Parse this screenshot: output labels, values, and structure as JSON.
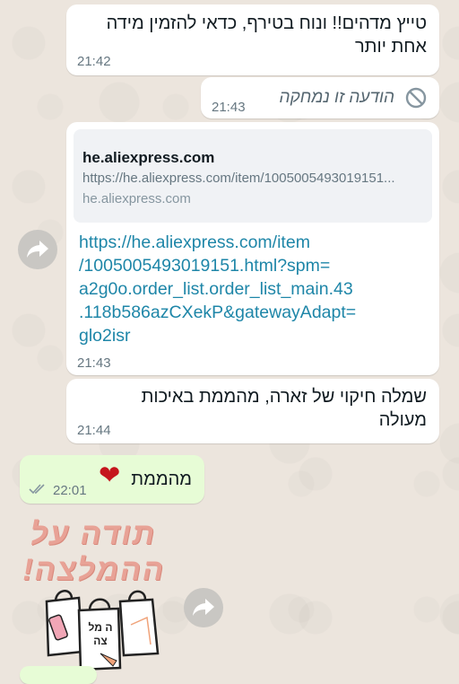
{
  "messages": [
    {
      "text_line1": "טייץ מדהים!! ונוח בטירף, כדאי להזמין מידה",
      "text_line2": "אחת יותר",
      "time": "21:42"
    },
    {
      "text": "הודעה זו נמחקה",
      "time": "21:43"
    },
    {
      "preview_title": "he.aliexpress.com",
      "preview_url": "https://he.aliexpress.com/item/1005005493019151...",
      "preview_domain": "he.aliexpress.com",
      "link_lines": [
        "https://he.aliexpress.com/item",
        "/1005005493019151.html?spm=",
        "a2g0o.order_list.order_list_main.43",
        ".118b586azCXekP&gatewayAdapt=",
        "glo2isr"
      ],
      "time": "21:43"
    },
    {
      "text_line1": "שמלה חיקוי של זארה, מהממת באיכות",
      "text_line2": "מעולה",
      "time": "21:44"
    },
    {
      "text": "מהממת",
      "emoji": "❤",
      "time": "22:01"
    }
  ],
  "sticker": {
    "line1": "תודה על",
    "line2": "ההמלצה!",
    "bag_text": "ה מל צה"
  },
  "colors": {
    "link": "#1e86a8",
    "out_bubble": "#e7fcd6",
    "ticks": "#8696a0"
  }
}
